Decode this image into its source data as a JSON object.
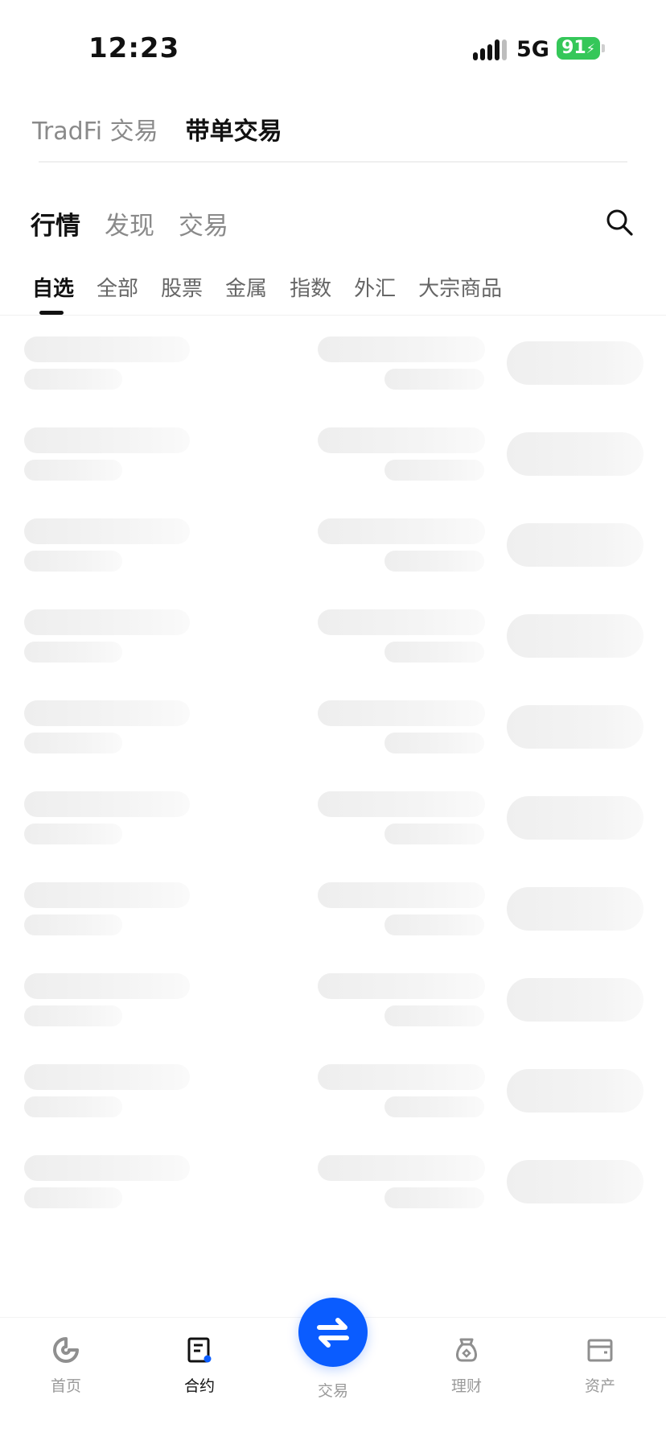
{
  "status_bar": {
    "time": "12:23",
    "network": "5G",
    "battery": "91"
  },
  "mode_tabs": [
    {
      "label": "TradFi 交易",
      "active": false
    },
    {
      "label": "带单交易",
      "active": true
    }
  ],
  "main_tabs": [
    {
      "label": "行情",
      "active": true
    },
    {
      "label": "发现",
      "active": false
    },
    {
      "label": "交易",
      "active": false
    }
  ],
  "category_tabs": [
    {
      "label": "自选",
      "active": true
    },
    {
      "label": "全部",
      "active": false
    },
    {
      "label": "股票",
      "active": false
    },
    {
      "label": "金属",
      "active": false
    },
    {
      "label": "指数",
      "active": false
    },
    {
      "label": "外汇",
      "active": false
    },
    {
      "label": "大宗商品",
      "active": false
    }
  ],
  "search_icon": "search-icon",
  "bottom_nav": {
    "items": [
      {
        "label": "首页",
        "icon": "home-icon",
        "active": false
      },
      {
        "label": "合约",
        "icon": "contract-icon",
        "active": true
      },
      {
        "label": "交易",
        "icon": "swap-icon",
        "active": false
      },
      {
        "label": "理财",
        "icon": "finance-icon",
        "active": false
      },
      {
        "label": "资产",
        "icon": "wallet-icon",
        "active": false
      }
    ]
  },
  "colors": {
    "accent": "#0a5cff",
    "battery": "#35c759",
    "skeleton": "#eeeeee"
  }
}
